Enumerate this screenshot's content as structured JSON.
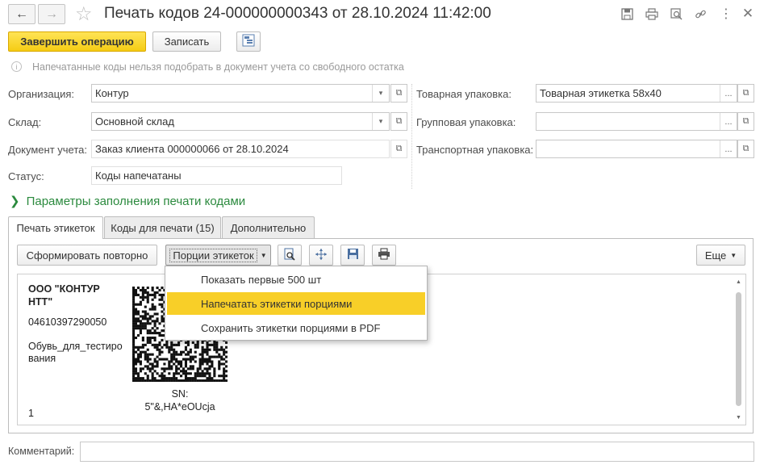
{
  "window": {
    "title": "Печать кодов 24-000000000343 от 28.10.2024 11:42:00",
    "nav_back_icon": "arrow-left-icon",
    "nav_forward_icon": "arrow-right-icon",
    "favorite_icon": "star-icon",
    "header_icons": [
      "save-icon",
      "print-icon",
      "search-icon",
      "link-icon",
      "more-icon",
      "close-icon"
    ]
  },
  "toolbar": {
    "finish_label": "Завершить операцию",
    "save_label": "Записать"
  },
  "hint": "Напечатанные коды нельзя подобрать в документ учета со свободного остатка",
  "form": {
    "org_label": "Организация:",
    "org_value": "Контур",
    "warehouse_label": "Склад:",
    "warehouse_value": "Основной склад",
    "doc_label": "Документ учета:",
    "doc_value": "Заказ клиента 000000066 от 28.10.2024",
    "status_label": "Статус:",
    "status_value": "Коды напечатаны",
    "product_pack_label": "Товарная упаковка:",
    "product_pack_value": "Товарная этикетка 58x40",
    "group_pack_label": "Групповая упаковка:",
    "group_pack_value": "",
    "transport_pack_label": "Транспортная упаковка:",
    "transport_pack_value": ""
  },
  "params_link": "Параметры заполнения печати кодами",
  "tabs": [
    {
      "label": "Печать этикеток",
      "active": true
    },
    {
      "label": "Коды для печати (15)",
      "active": false
    },
    {
      "label": "Дополнительно",
      "active": false
    }
  ],
  "tab_toolbar": {
    "regenerate_label": "Сформировать повторно",
    "portions_label": "Порции этикеток",
    "more_label": "Еще"
  },
  "portions_menu": [
    {
      "label": "Показать первые 500 шт",
      "highlighted": false
    },
    {
      "label": "Напечатать этикетки порциями",
      "highlighted": true
    },
    {
      "label": "Сохранить этикетки порциями в PDF",
      "highlighted": false
    }
  ],
  "label_preview": {
    "company_line1": "ООО \"КОНТУР",
    "company_line2": "НТТ\"",
    "gtin": "04610397290050",
    "name_line1": "Обувь_для_тестиро",
    "name_line2": "вания",
    "sn_label": "SN:",
    "sn_value": "5\"&,HA*eOUcja",
    "count": "1"
  },
  "comment_label": "Комментарий:",
  "comment_value": "",
  "colors": {
    "accent_yellow": "#f5cc14",
    "link_green": "#2b8a3e",
    "menu_highlight": "#f8cf28"
  }
}
